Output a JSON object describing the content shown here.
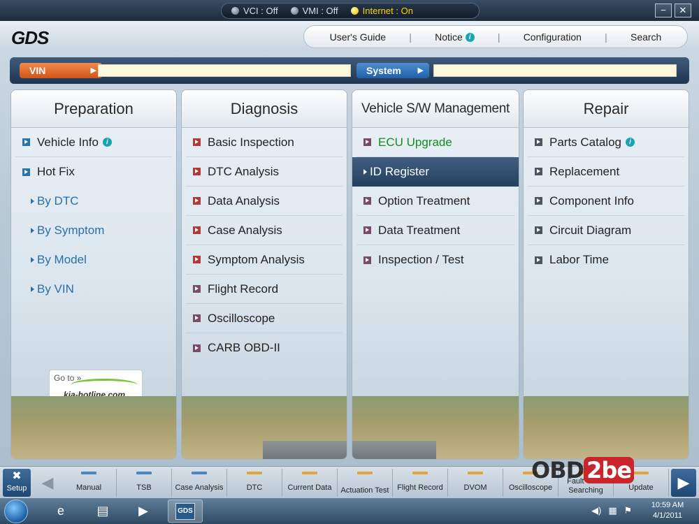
{
  "status": {
    "vci": "VCI : Off",
    "vmi": "VMI : Off",
    "internet": "Internet : On",
    "minimize": "−",
    "close": "✕"
  },
  "logo": {
    "text": "GDS"
  },
  "topnav": {
    "users_guide": "User's Guide",
    "notice": "Notice",
    "configuration": "Configuration",
    "search": "Search",
    "separator": "|"
  },
  "vin_bar": {
    "vin_label": "VIN",
    "vin_value": "",
    "system_label": "System",
    "system_value": ""
  },
  "columns": [
    {
      "title": "Preparation",
      "items": [
        {
          "label": "Vehicle Info",
          "info": true
        },
        {
          "label": "Hot Fix"
        },
        {
          "label": "By DTC"
        },
        {
          "label": "By Symptom"
        },
        {
          "label": "By Model"
        },
        {
          "label": "By VIN"
        }
      ]
    },
    {
      "title": "Diagnosis",
      "items": [
        {
          "label": "Basic Inspection"
        },
        {
          "label": "DTC Analysis"
        },
        {
          "label": "Data Analysis"
        },
        {
          "label": "Case Analysis"
        },
        {
          "label": "Symptom Analysis"
        },
        {
          "label": "Flight Record"
        },
        {
          "label": "Oscilloscope"
        },
        {
          "label": "CARB OBD-II"
        }
      ]
    },
    {
      "title": "Vehicle S/W Management",
      "items": [
        {
          "label": "ECU Upgrade"
        },
        {
          "label": "ID Register"
        },
        {
          "label": "Option Treatment"
        },
        {
          "label": "Data Treatment"
        },
        {
          "label": "Inspection / Test"
        }
      ]
    },
    {
      "title": "Repair",
      "items": [
        {
          "label": "Parts Catalog",
          "info": true
        },
        {
          "label": "Replacement"
        },
        {
          "label": "Component Info"
        },
        {
          "label": "Circuit Diagram"
        },
        {
          "label": "Labor Time"
        }
      ]
    }
  ],
  "promo": {
    "goto": "Go to »",
    "site": "kia-hotline.com"
  },
  "toolbar": {
    "setup": "Setup",
    "tabs": [
      {
        "label": "Manual",
        "color": "#4a86c0"
      },
      {
        "label": "TSB",
        "color": "#4a86c0"
      },
      {
        "label": "Case Analysis",
        "color": "#4a86c0"
      },
      {
        "label": "DTC",
        "color": "#e0a63a"
      },
      {
        "label": "Current Data",
        "color": "#e0a63a"
      },
      {
        "label": "Actuation Test",
        "color": "#e0a63a"
      },
      {
        "label": "Flight Record",
        "color": "#e0a63a"
      },
      {
        "label": "DVOM",
        "color": "#e0a63a"
      },
      {
        "label": "Oscilloscope",
        "color": "#e0a63a"
      },
      {
        "label": "Fault Code Searching",
        "color": "#e0a63a"
      },
      {
        "label": "Update",
        "color": "#e0a63a"
      }
    ]
  },
  "watermark": {
    "obd": "OBD",
    "two": "2be"
  },
  "taskbar": {
    "time": "10:59 AM",
    "date": "4/1/2011",
    "gds_app": "GDS"
  }
}
